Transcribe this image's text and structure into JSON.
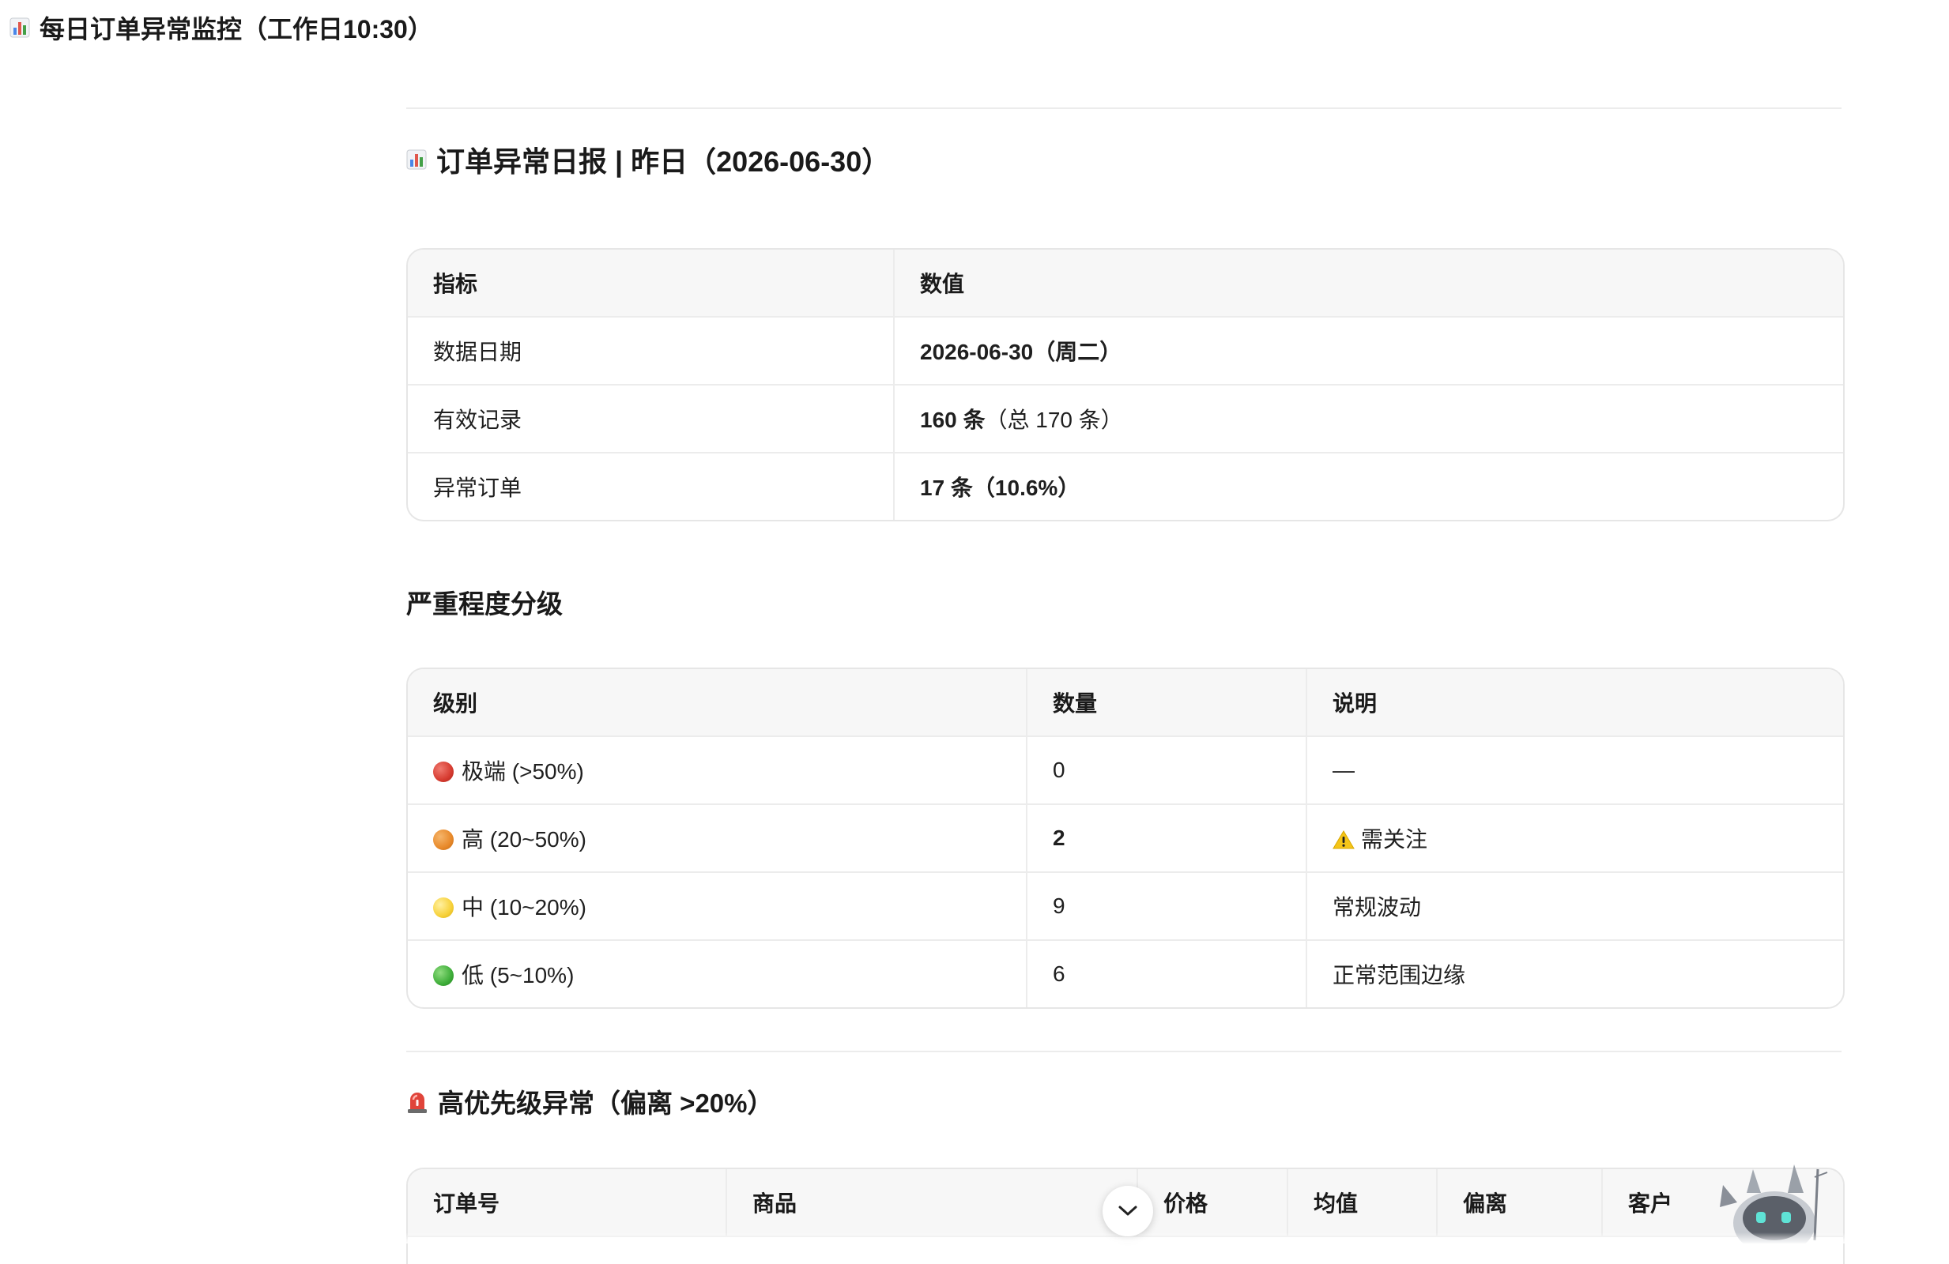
{
  "page": {
    "title": "每日订单异常监控（工作日10:30）",
    "title_icon": "bar-chart-icon"
  },
  "report": {
    "title": "订单异常日报 | 昨日（2026-06-30）",
    "title_icon": "bar-chart-icon",
    "summary_table": {
      "headers": [
        "指标",
        "数值"
      ],
      "rows": [
        {
          "label": "数据日期",
          "value_bold": "2026-06-30（周二）",
          "value_rest": ""
        },
        {
          "label": "有效记录",
          "value_bold": "160 条",
          "value_rest": "（总 170 条）"
        },
        {
          "label": "异常订单",
          "value_bold": "17 条（10.6%）",
          "value_rest": ""
        }
      ]
    }
  },
  "severity": {
    "title": "严重程度分级",
    "headers": [
      "级别",
      "数量",
      "说明"
    ],
    "rows": [
      {
        "level": "极端 (>50%)",
        "dot_color": "#d63b30",
        "count": "0",
        "count_bold": false,
        "note": "—",
        "note_icon": ""
      },
      {
        "level": "高 (20~50%)",
        "dot_color": "#e8892a",
        "count": "2",
        "count_bold": true,
        "note": "需关注",
        "note_icon": "warning-icon"
      },
      {
        "level": "中 (10~20%)",
        "dot_color": "#f7d13a",
        "count": "9",
        "count_bold": false,
        "note": "常规波动",
        "note_icon": ""
      },
      {
        "level": "低 (5~10%)",
        "dot_color": "#3fae3a",
        "count": "6",
        "count_bold": false,
        "note": "正常范围边缘",
        "note_icon": ""
      }
    ]
  },
  "priority": {
    "title": "高优先级异常（偏离 >20%）",
    "title_icon": "siren-icon",
    "headers": [
      "订单号",
      "商品",
      "价格",
      "均值",
      "偏离",
      "客户"
    ]
  },
  "controls": {
    "scroll_down_icon": "chevron-down-icon",
    "mascot_icon": "robot-mascot-icon"
  }
}
